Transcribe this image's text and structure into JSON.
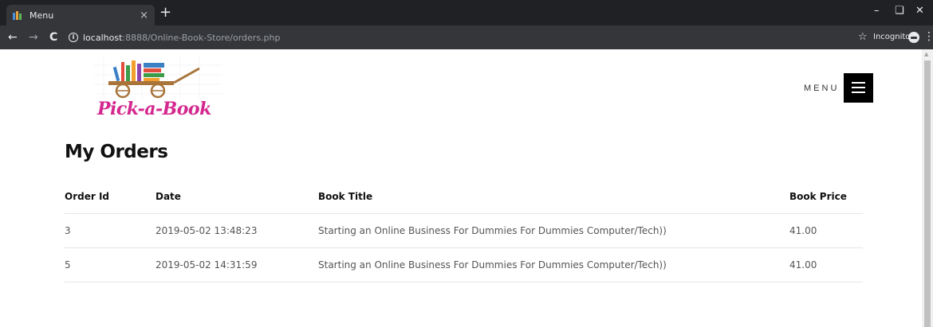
{
  "browser": {
    "tab_title": "Menu",
    "tab_close": "×",
    "new_tab": "+",
    "url_host": "localhost",
    "url_rest": ":8888/Online-Book-Store/orders.php",
    "incognito": "Incognito"
  },
  "site": {
    "logo_text": "Pick-a-Book",
    "menu_label": "MENU"
  },
  "page": {
    "title": "My Orders"
  },
  "table": {
    "headers": [
      "Order Id",
      "Date",
      "Book Title",
      "Book Price"
    ],
    "rows": [
      [
        "3",
        "2019-05-02 13:48:23",
        "Starting an Online Business For Dummies For Dummies Computer/Tech))",
        "41.00"
      ],
      [
        "5",
        "2019-05-02 14:31:59",
        "Starting an Online Business For Dummies For Dummies Computer/Tech))",
        "41.00"
      ]
    ]
  },
  "colors": {
    "chrome_dark": "#202124",
    "chrome_bar": "#35363a",
    "logo_pink": "#d4288f",
    "menu_button": "#000000"
  }
}
